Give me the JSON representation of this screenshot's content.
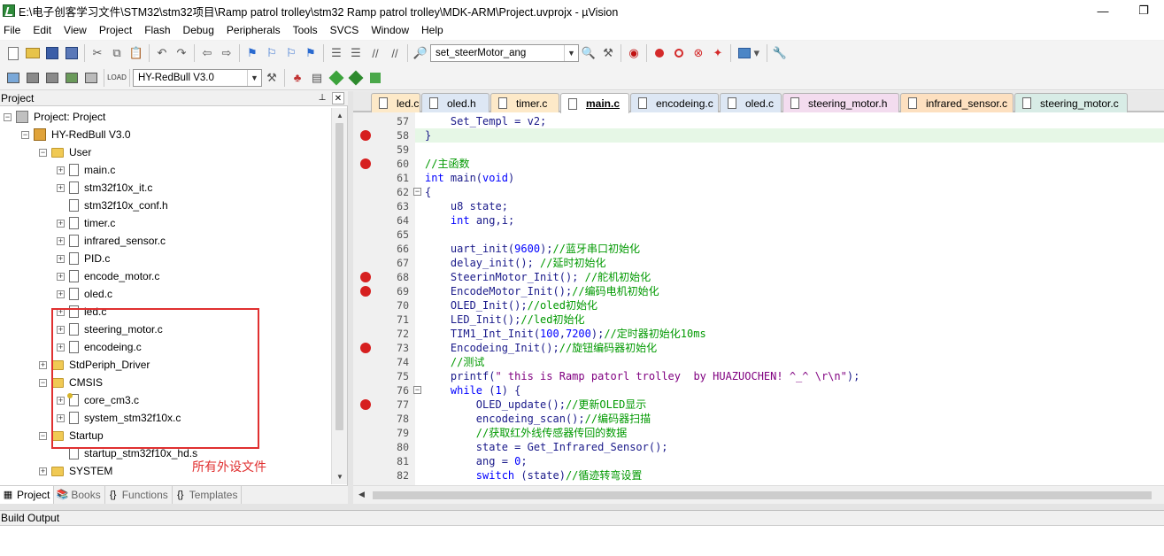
{
  "window": {
    "title": "E:\\电子创客学习文件\\STM32\\stm32项目\\Ramp patrol trolley\\stm32 Ramp patrol trolley\\MDK-ARM\\Project.uvprojx - µVision",
    "icon": "uvision-app-icon"
  },
  "menu": [
    "File",
    "Edit",
    "View",
    "Project",
    "Flash",
    "Debug",
    "Peripherals",
    "Tools",
    "SVCS",
    "Window",
    "Help"
  ],
  "toolbar": {
    "find_combo_value": "set_steerMotor_ang",
    "target_combo_value": "HY-RedBull V3.0"
  },
  "project_panel": {
    "title": "Project",
    "tree": [
      {
        "label": "Project: Project",
        "level": 0,
        "type": "proj"
      },
      {
        "label": "HY-RedBull V3.0",
        "level": 1,
        "type": "target"
      },
      {
        "label": "User",
        "level": 2,
        "type": "folder"
      },
      {
        "label": "main.c",
        "level": 3,
        "type": "file"
      },
      {
        "label": "stm32f10x_it.c",
        "level": 3,
        "type": "file"
      },
      {
        "label": "stm32f10x_conf.h",
        "level": 3,
        "type": "file"
      },
      {
        "label": "timer.c",
        "level": 3,
        "type": "file"
      },
      {
        "label": "infrared_sensor.c",
        "level": 3,
        "type": "file"
      },
      {
        "label": "PID.c",
        "level": 3,
        "type": "file"
      },
      {
        "label": "encode_motor.c",
        "level": 3,
        "type": "file"
      },
      {
        "label": "oled.c",
        "level": 3,
        "type": "file"
      },
      {
        "label": "led.c",
        "level": 3,
        "type": "file"
      },
      {
        "label": "steering_motor.c",
        "level": 3,
        "type": "file"
      },
      {
        "label": "encodeing.c",
        "level": 3,
        "type": "file"
      },
      {
        "label": "StdPeriph_Driver",
        "level": 2,
        "type": "folder"
      },
      {
        "label": "CMSIS",
        "level": 2,
        "type": "folder"
      },
      {
        "label": "core_cm3.c",
        "level": 3,
        "type": "keyfile"
      },
      {
        "label": "system_stm32f10x.c",
        "level": 3,
        "type": "file"
      },
      {
        "label": "Startup",
        "level": 2,
        "type": "folder"
      },
      {
        "label": "startup_stm32f10x_hd.s",
        "level": 3,
        "type": "file"
      },
      {
        "label": "SYSTEM",
        "level": 2,
        "type": "folder"
      }
    ],
    "annotation": "所有外设文件",
    "tabs": [
      "Project",
      "Books",
      "Functions",
      "Templates"
    ]
  },
  "editor_tabs": [
    {
      "label": "led.c",
      "color": "#fde9c8"
    },
    {
      "label": "oled.h",
      "color": "#dde7f4"
    },
    {
      "label": "timer.c",
      "color": "#fde9c8"
    },
    {
      "label": "main.c",
      "color": "#ffffff"
    },
    {
      "label": "encodeing.c",
      "color": "#dde7f4"
    },
    {
      "label": "oled.c",
      "color": "#dde7f4"
    },
    {
      "label": "steering_motor.h",
      "color": "#f3dcef"
    },
    {
      "label": "infrared_sensor.c",
      "color": "#fde0c0"
    },
    {
      "label": "steering_motor.c",
      "color": "#d8ece6"
    }
  ],
  "code_lines": [
    {
      "n": "57",
      "bp": false,
      "fold": false,
      "parts": [
        {
          "t": "    Set_Templ = v2;",
          "c": "n"
        }
      ]
    },
    {
      "n": "58",
      "bp": true,
      "fold": false,
      "hl": true,
      "parts": [
        {
          "t": "}",
          "c": "n"
        }
      ]
    },
    {
      "n": "59",
      "bp": false,
      "fold": false,
      "parts": []
    },
    {
      "n": "60",
      "bp": true,
      "fold": false,
      "parts": [
        {
          "t": "//主函数",
          "c": "cmt"
        }
      ]
    },
    {
      "n": "61",
      "bp": false,
      "fold": false,
      "parts": [
        {
          "t": "int",
          "c": "kw"
        },
        {
          "t": " main(",
          "c": "n"
        },
        {
          "t": "void",
          "c": "kw"
        },
        {
          "t": ")",
          "c": "n"
        }
      ]
    },
    {
      "n": "62",
      "bp": false,
      "fold": true,
      "parts": [
        {
          "t": "{",
          "c": "n"
        }
      ]
    },
    {
      "n": "63",
      "bp": false,
      "fold": false,
      "parts": [
        {
          "t": "    u8 state;",
          "c": "n"
        }
      ]
    },
    {
      "n": "64",
      "bp": false,
      "fold": false,
      "parts": [
        {
          "t": "    ",
          "c": "n"
        },
        {
          "t": "int",
          "c": "kw"
        },
        {
          "t": " ang,i;",
          "c": "n"
        }
      ]
    },
    {
      "n": "65",
      "bp": false,
      "fold": false,
      "parts": []
    },
    {
      "n": "66",
      "bp": false,
      "fold": false,
      "parts": [
        {
          "t": "    uart_init(",
          "c": "n"
        },
        {
          "t": "9600",
          "c": "num"
        },
        {
          "t": ");",
          "c": "n"
        },
        {
          "t": "//蓝牙串口初始化",
          "c": "cmt"
        }
      ]
    },
    {
      "n": "67",
      "bp": false,
      "fold": false,
      "parts": [
        {
          "t": "    delay_init(); ",
          "c": "n"
        },
        {
          "t": "//延时初始化",
          "c": "cmt"
        }
      ]
    },
    {
      "n": "68",
      "bp": true,
      "fold": false,
      "parts": [
        {
          "t": "    SteerinMotor_Init(); ",
          "c": "n"
        },
        {
          "t": "//舵机初始化",
          "c": "cmt"
        }
      ]
    },
    {
      "n": "69",
      "bp": true,
      "fold": false,
      "parts": [
        {
          "t": "    EncodeMotor_Init();",
          "c": "n"
        },
        {
          "t": "//编码电机初始化",
          "c": "cmt"
        }
      ]
    },
    {
      "n": "70",
      "bp": false,
      "fold": false,
      "parts": [
        {
          "t": "    OLED_Init();",
          "c": "n"
        },
        {
          "t": "//oled初始化",
          "c": "cmt"
        }
      ]
    },
    {
      "n": "71",
      "bp": false,
      "fold": false,
      "parts": [
        {
          "t": "    LED_Init();",
          "c": "n"
        },
        {
          "t": "//led初始化",
          "c": "cmt"
        }
      ]
    },
    {
      "n": "72",
      "bp": false,
      "fold": false,
      "parts": [
        {
          "t": "    TIM1_Int_Init(",
          "c": "n"
        },
        {
          "t": "100",
          "c": "num"
        },
        {
          "t": ",",
          "c": "n"
        },
        {
          "t": "7200",
          "c": "num"
        },
        {
          "t": ");",
          "c": "n"
        },
        {
          "t": "//定时器初始化10ms",
          "c": "cmt"
        }
      ]
    },
    {
      "n": "73",
      "bp": true,
      "fold": false,
      "parts": [
        {
          "t": "    Encodeing_Init();",
          "c": "n"
        },
        {
          "t": "//旋钮编码器初始化",
          "c": "cmt"
        }
      ]
    },
    {
      "n": "74",
      "bp": false,
      "fold": false,
      "parts": [
        {
          "t": "    ",
          "c": "n"
        },
        {
          "t": "//测试",
          "c": "cmt"
        }
      ]
    },
    {
      "n": "75",
      "bp": false,
      "fold": false,
      "parts": [
        {
          "t": "    printf(",
          "c": "n"
        },
        {
          "t": "\" this is Ramp patorl trolley  by HUAZUOCHEN! ^_^ \\r\\n\"",
          "c": "str"
        },
        {
          "t": ");",
          "c": "n"
        }
      ]
    },
    {
      "n": "76",
      "bp": false,
      "fold": true,
      "parts": [
        {
          "t": "    ",
          "c": "n"
        },
        {
          "t": "while",
          "c": "kw"
        },
        {
          "t": " (",
          "c": "n"
        },
        {
          "t": "1",
          "c": "num"
        },
        {
          "t": ") {",
          "c": "n"
        }
      ]
    },
    {
      "n": "77",
      "bp": true,
      "fold": false,
      "parts": [
        {
          "t": "        OLED_update();",
          "c": "n"
        },
        {
          "t": "//更新OLED显示",
          "c": "cmt"
        }
      ]
    },
    {
      "n": "78",
      "bp": false,
      "fold": false,
      "parts": [
        {
          "t": "        encodeing_scan();",
          "c": "n"
        },
        {
          "t": "//编码器扫描",
          "c": "cmt"
        }
      ]
    },
    {
      "n": "79",
      "bp": false,
      "fold": false,
      "parts": [
        {
          "t": "        ",
          "c": "n"
        },
        {
          "t": "//获取红外线传感器传回的数据",
          "c": "cmt"
        }
      ]
    },
    {
      "n": "80",
      "bp": false,
      "fold": false,
      "parts": [
        {
          "t": "        state = Get_Infrared_Sensor();",
          "c": "n"
        }
      ]
    },
    {
      "n": "81",
      "bp": false,
      "fold": false,
      "parts": [
        {
          "t": "        ang = ",
          "c": "n"
        },
        {
          "t": "0",
          "c": "num"
        },
        {
          "t": ";",
          "c": "n"
        }
      ]
    },
    {
      "n": "82",
      "bp": false,
      "fold": false,
      "parts": [
        {
          "t": "        ",
          "c": "n"
        },
        {
          "t": "switch",
          "c": "kw"
        },
        {
          "t": " (state)",
          "c": "n"
        },
        {
          "t": "//循迹转弯设置",
          "c": "cmt"
        }
      ]
    }
  ],
  "build_output": {
    "title": "Build Output"
  }
}
